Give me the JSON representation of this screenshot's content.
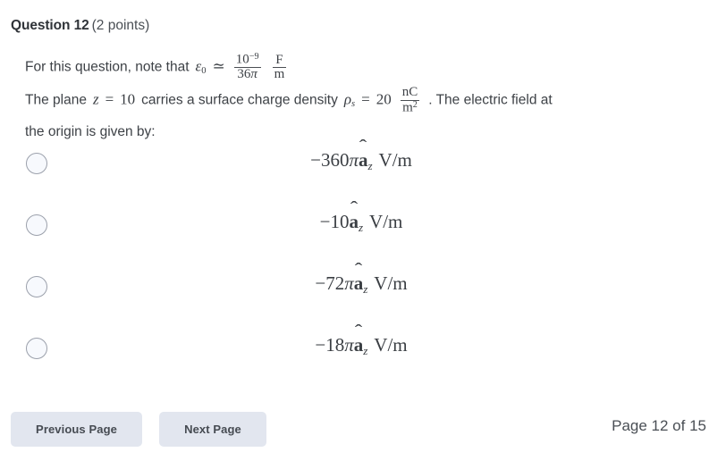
{
  "header": {
    "question_label": "Question 12",
    "points": "(2 points)"
  },
  "question": {
    "line1_prefix": "For this question, note that",
    "epsilon_symbol": "ε",
    "epsilon_subscript": "0",
    "approx_symbol": "≃",
    "permittivity_numerator": "10",
    "permittivity_numerator_exp": "−9",
    "permittivity_denominator_value": "36",
    "permittivity_denominator_pi": "π",
    "permittivity_unit_numerator": "F",
    "permittivity_unit_denominator": "m",
    "line2_a": "The plane",
    "plane_var": "z",
    "plane_eq": "=",
    "plane_value": "10",
    "line2_b": "carries a surface charge density",
    "rho_symbol": "ρ",
    "rho_subscript": "s",
    "rho_eq": "=",
    "rho_value": "20",
    "rho_unit_numerator": "nC",
    "rho_unit_denominator": "m",
    "rho_unit_denominator_exp": "2",
    "line2_c": ". The electric field at",
    "line3": "the origin is given by:"
  },
  "options": [
    {
      "id": "option-a",
      "sign": "−",
      "coefficient": "360",
      "pi": "π",
      "vector": "a",
      "hat": "̂",
      "subscript": "z",
      "unit": "V/m",
      "selected": false
    },
    {
      "id": "option-b",
      "sign": "−",
      "coefficient": "10",
      "pi": "",
      "vector": "a",
      "hat": "̂",
      "subscript": "z",
      "unit": "V/m",
      "selected": false
    },
    {
      "id": "option-c",
      "sign": "−",
      "coefficient": "72",
      "pi": "π",
      "vector": "a",
      "hat": "̂",
      "subscript": "z",
      "unit": "V/m",
      "selected": false
    },
    {
      "id": "option-d",
      "sign": "−",
      "coefficient": "18",
      "pi": "π",
      "vector": "a",
      "hat": "̂",
      "subscript": "z",
      "unit": "V/m",
      "selected": false
    }
  ],
  "footer": {
    "previous_label": "Previous Page",
    "next_label": "Next Page",
    "page_indicator": "Page 12 of 15"
  },
  "colors": {
    "background": "#ffffff",
    "text": "#3e4247",
    "button_background": "#e2e6ef",
    "button_text": "#464b52",
    "radio_border": "#9ba0ab",
    "radio_fill": "#f7f9fd"
  }
}
